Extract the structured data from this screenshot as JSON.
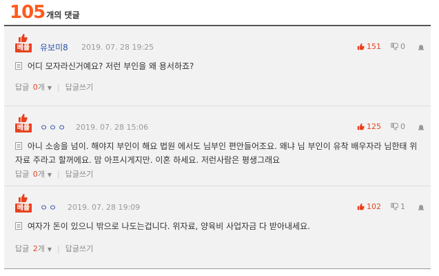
{
  "header": {
    "count": "105",
    "count_suffix": "개의 댓글"
  },
  "comments": [
    {
      "best_label": "베플",
      "nick": "유보미8",
      "date": "2019. 07. 28 19:25",
      "up": "151",
      "down": "0",
      "text": "어디 모자라신거예요? 저런 부인을 왜 용서하죠?",
      "reply_label": "답글",
      "reply_count": "0",
      "reply_unit": "개",
      "write_label": "답글쓰기"
    },
    {
      "best_label": "베플",
      "nick": "ㅇㅇㅇ",
      "date": "2019. 07. 28 15:06",
      "up": "125",
      "down": "0",
      "text": "아니 소송을 넘이. 해야지 부인이 해요 법원 에서도 님부인 편안들어조요. 왜냐 님 부인이 유착 배우자라 님한태 위자료 주라고 할꺼에요. 맘 아프시게지만. 이혼 하세요. 저런사람은 평생그래요",
      "reply_label": "답글",
      "reply_count": "0",
      "reply_unit": "개",
      "write_label": "답글쓰기"
    },
    {
      "best_label": "베플",
      "nick": "ㅇㅇ",
      "date": "2019. 07. 28 19:09",
      "up": "102",
      "down": "1",
      "text": "여자가 돈이 있으니 밖으로 나도는겁니다. 위자료, 양육비 사업자금 다 받아내세요.",
      "reply_label": "답글",
      "reply_count": "2",
      "reply_unit": "개",
      "write_label": "답글쓰기"
    }
  ],
  "icons": {
    "thumb_up": "thumb-up-icon",
    "thumb_down": "thumb-down-icon",
    "report": "report-icon",
    "doc": "document-icon"
  },
  "colors": {
    "accent": "#e8411e",
    "count": "#ff5a1e",
    "nick": "#2a52a8"
  }
}
